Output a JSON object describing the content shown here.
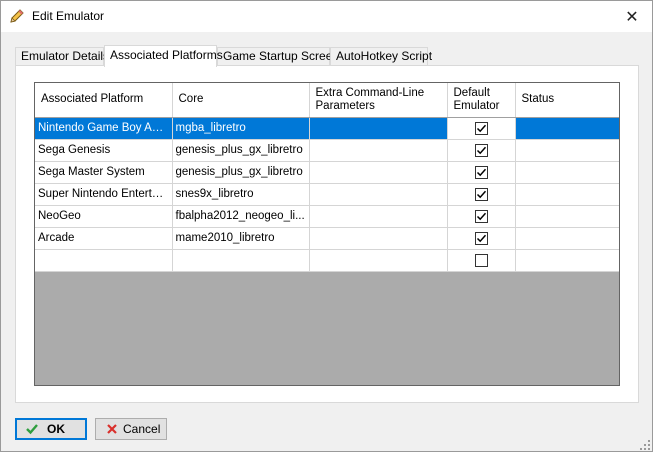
{
  "window": {
    "title": "Edit Emulator",
    "close_glyph": "✕"
  },
  "tabs": [
    {
      "label": "Emulator Details",
      "active": false
    },
    {
      "label": "Associated Platforms",
      "active": true
    },
    {
      "label": "Game Startup Screen",
      "active": false
    },
    {
      "label": "AutoHotkey Script",
      "active": false
    }
  ],
  "grid": {
    "headers": {
      "platform": "Associated Platform",
      "core": "Core",
      "params": "Extra Command-Line Parameters",
      "default": "Default Emulator",
      "status": "Status"
    },
    "rows": [
      {
        "platform": "Nintendo Game Boy Adv...",
        "core": "mgba_libretro",
        "params": "",
        "default": true,
        "status": "",
        "selected": true
      },
      {
        "platform": "Sega Genesis",
        "core": "genesis_plus_gx_libretro",
        "params": "",
        "default": true,
        "status": ""
      },
      {
        "platform": "Sega Master System",
        "core": "genesis_plus_gx_libretro",
        "params": "",
        "default": true,
        "status": ""
      },
      {
        "platform": "Super Nintendo Entertai...",
        "core": "snes9x_libretro",
        "params": "",
        "default": true,
        "status": ""
      },
      {
        "platform": "NeoGeo",
        "core": "fbalpha2012_neogeo_li...",
        "params": "",
        "default": true,
        "status": ""
      },
      {
        "platform": "Arcade",
        "core": "mame2010_libretro",
        "params": "",
        "default": true,
        "status": ""
      },
      {
        "platform": "",
        "core": "",
        "params": "",
        "default": false,
        "status": ""
      }
    ]
  },
  "buttons": {
    "ok": "OK",
    "cancel": "Cancel"
  },
  "icons": {
    "title": "pencil-icon",
    "ok": "checkmark-icon",
    "cancel": "x-icon"
  },
  "colors": {
    "selection": "#0078d7",
    "ok_border": "#0078d7"
  }
}
